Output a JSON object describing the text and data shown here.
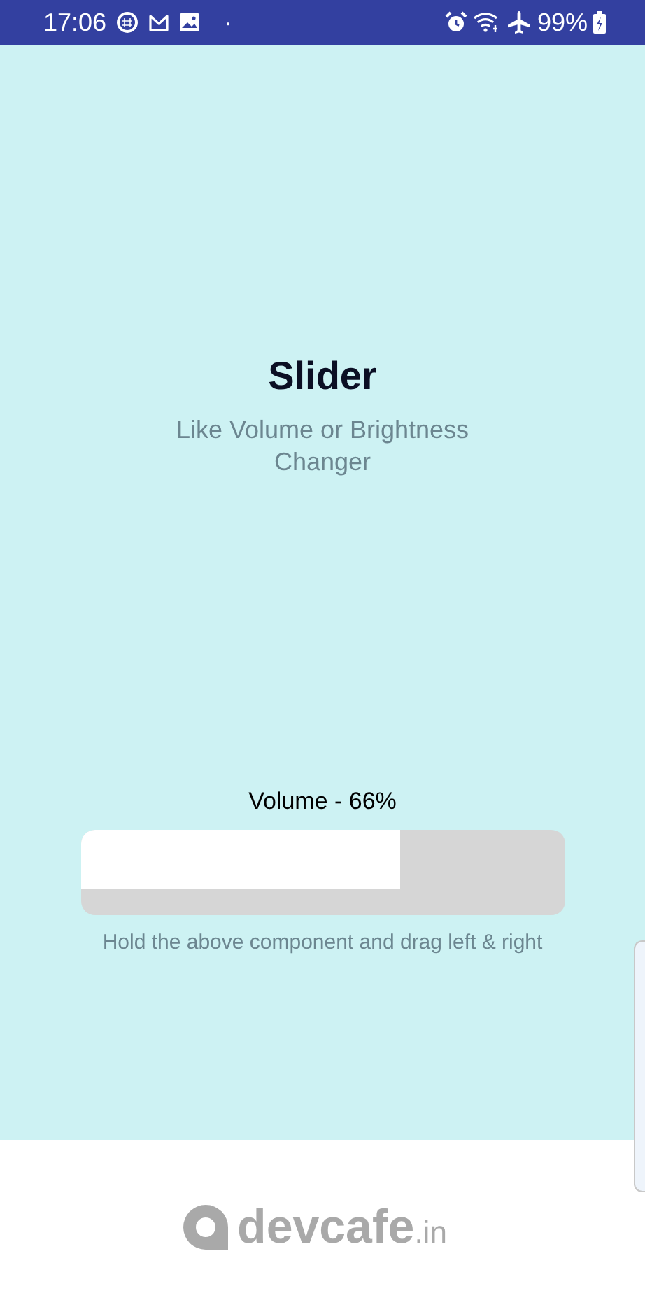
{
  "status_bar": {
    "time": "17:06",
    "notification_dot": "·",
    "battery": "99%"
  },
  "header": {
    "title": "Slider",
    "subtitle": "Like Volume or Brightness Changer"
  },
  "slider": {
    "label": "Volume - 66%",
    "level": 0.66,
    "hint": "Hold the above component and drag left & right"
  },
  "footer": {
    "logo_text": "devcafe",
    "logo_suffix": ".in"
  }
}
